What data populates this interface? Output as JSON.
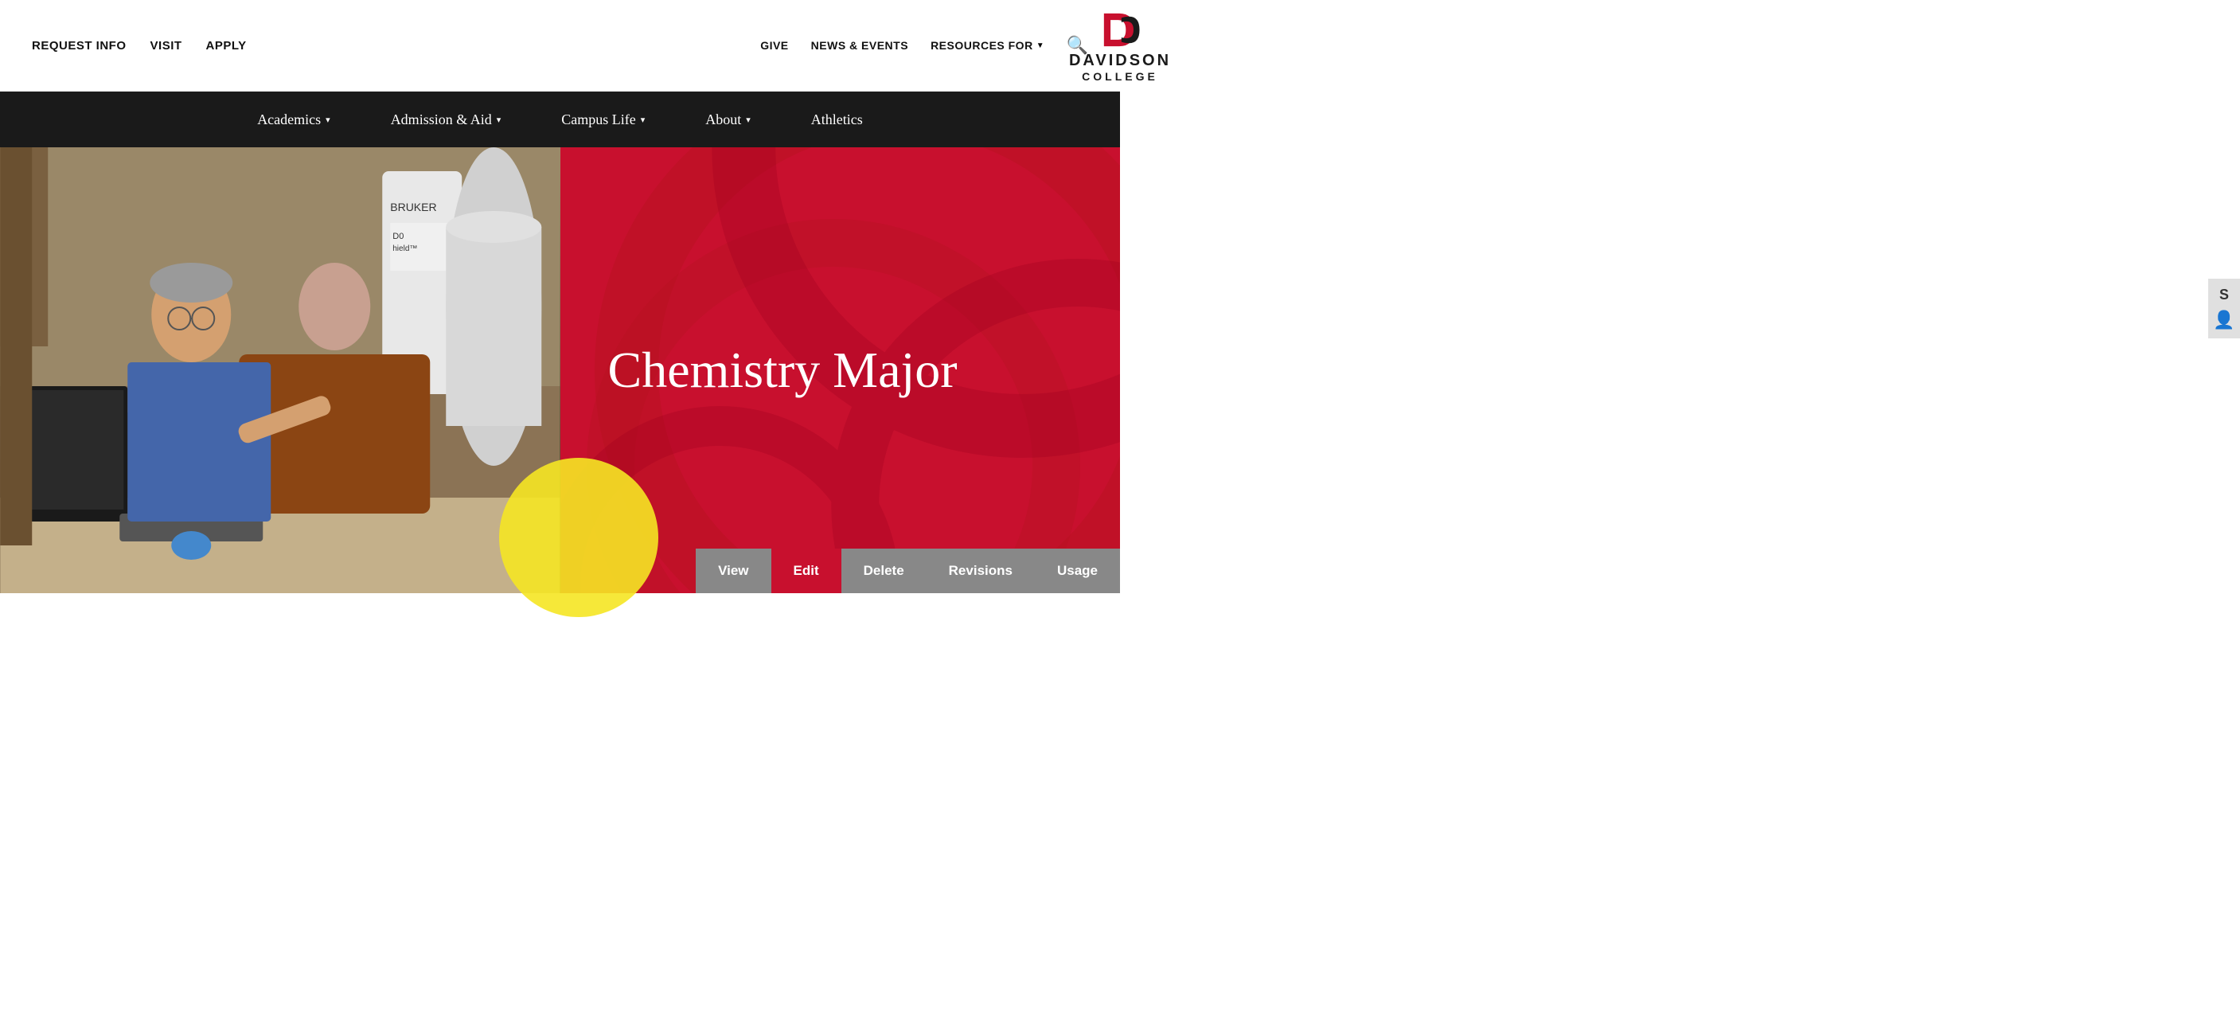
{
  "topbar": {
    "request_info": "REQUEST INFO",
    "visit": "VISIT",
    "apply": "APPLY",
    "give": "GIVE",
    "news_events": "NEWS & EVENTS",
    "resources_for": "RESOURCES FOR",
    "logo_name": "DAVIDSON",
    "logo_college": "COLLEGE"
  },
  "nav": {
    "academics": "Academics",
    "admission_aid": "Admission & Aid",
    "campus_life": "Campus Life",
    "about": "About",
    "athletics": "Athletics"
  },
  "hero": {
    "title": "Chemistry Major"
  },
  "admin": {
    "view": "View",
    "edit": "Edit",
    "delete": "Delete",
    "revisions": "Revisions",
    "usage": "Usage"
  }
}
